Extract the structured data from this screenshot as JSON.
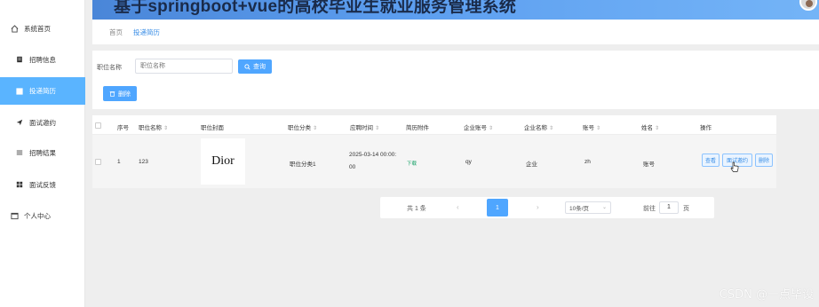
{
  "app": {
    "title": "基于springboot+vue的高校毕业生就业服务管理系统"
  },
  "sidebar": {
    "items": [
      {
        "label": "系统首页",
        "icon": "home-icon"
      },
      {
        "label": "招聘信息",
        "icon": "document-icon"
      },
      {
        "label": "投递简历",
        "icon": "grid-icon",
        "active": true
      },
      {
        "label": "面试邀约",
        "icon": "send-icon"
      },
      {
        "label": "招聘结果",
        "icon": "list-icon"
      },
      {
        "label": "面试反馈",
        "icon": "grid-icon"
      },
      {
        "label": "个人中心",
        "icon": "window-icon"
      }
    ]
  },
  "breadcrumb": {
    "home": "首页",
    "current": "投递简历"
  },
  "search": {
    "label": "职位名称",
    "placeholder": "职位名称",
    "button": "查询"
  },
  "actions": {
    "delete": "删除"
  },
  "table": {
    "headers": [
      "序号",
      "职位名称",
      "职位封面",
      "职位分类",
      "应聘时间",
      "简历附件",
      "企业账号",
      "企业名称",
      "账号",
      "姓名",
      "操作"
    ],
    "rows": [
      {
        "index": "1",
        "job_name": "123",
        "cover": "Dior",
        "category": "职位分类1",
        "time_line1": "2025-03-14 00:00:",
        "time_line2": "00",
        "attachment": "下载",
        "company_account": "qy",
        "company_name": "企业",
        "account": "zh",
        "name": "账号",
        "ops": [
          "查看",
          "面试邀约",
          "删除"
        ]
      }
    ]
  },
  "pagination": {
    "total": "共 1 条",
    "prev": "‹",
    "current": "1",
    "next": "›",
    "page_size": "10条/页",
    "goto_label": "前往",
    "goto_value": "1",
    "page_unit": "页"
  },
  "watermark": "CSDN @一点毕设",
  "colors": {
    "accent": "#4fa6ff",
    "header_from": "#4a86d8",
    "header_to": "#74b4f7",
    "active_menu": "#5ab4ff"
  }
}
